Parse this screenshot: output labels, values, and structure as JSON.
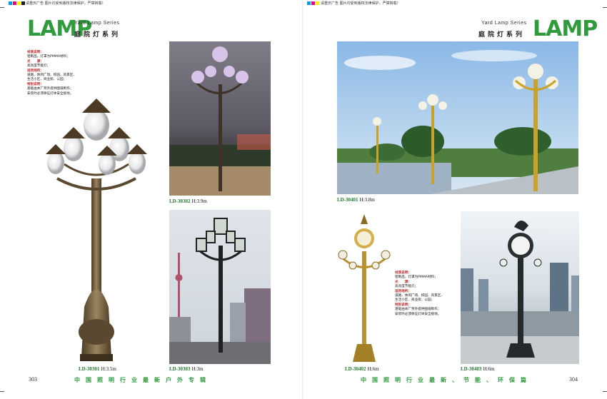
{
  "print_marks": {
    "left_note": "请重庆广告 图片均受到版权法律保护，严禁转载！",
    "right_note": "请重庆广告 图片均受到版权法律保护，严禁转载！",
    "swatch_colors": [
      "#00a0e9",
      "#e4007f",
      "#fff100",
      "#231815",
      "#00a0e9",
      "#e4007f",
      "#fff100"
    ]
  },
  "left_page": {
    "logo": "LAMP",
    "series_en": "Yard Lamp Series",
    "series_cn": "庭院灯系列",
    "specs": [
      {
        "kind": "h",
        "text": "材质说明："
      },
      {
        "kind": "t",
        "text": "铝制品，灯罩为PMMA材料；"
      },
      {
        "kind": "h",
        "text": "光　　源："
      },
      {
        "kind": "t",
        "text": "高亮度节能灯；"
      },
      {
        "kind": "h",
        "text": "适用场所："
      },
      {
        "kind": "t",
        "text": "道路、休闲广场、校园、风景区、"
      },
      {
        "kind": "t",
        "text": "生活小区、商业街、公园；"
      },
      {
        "kind": "h",
        "text": "特别说明："
      },
      {
        "kind": "t",
        "text": "基础由本厂另外提供图纸制作；"
      },
      {
        "kind": "t",
        "text": "安装时必须保证灯体安全接地。"
      }
    ],
    "products": [
      {
        "code": "LD-30301",
        "height": "H:3.5m"
      },
      {
        "code": "LD-30302",
        "height": "H:3.9m"
      },
      {
        "code": "LD-30303",
        "height": "H:3m"
      }
    ],
    "page_number": "303",
    "footer": "中国照明行业最新户外专辑"
  },
  "right_page": {
    "logo": "LAMP",
    "series_en": "Yard Lamp Series",
    "series_cn": "庭院灯系列",
    "specs": [
      {
        "kind": "h",
        "text": "材质说明："
      },
      {
        "kind": "t",
        "text": "铝制品，灯罩为PMMA材料；"
      },
      {
        "kind": "h",
        "text": "光　　源："
      },
      {
        "kind": "t",
        "text": "高亮度节能灯；"
      },
      {
        "kind": "h",
        "text": "适用场所："
      },
      {
        "kind": "t",
        "text": "道路、休闲广场、校园、风景区、"
      },
      {
        "kind": "t",
        "text": "生活小区、商业街、公园；"
      },
      {
        "kind": "h",
        "text": "特别说明："
      },
      {
        "kind": "t",
        "text": "基础由本厂另外提供图纸制作；"
      },
      {
        "kind": "t",
        "text": "安装时必须保证灯体安全接地。"
      }
    ],
    "products": [
      {
        "code": "LD-30401",
        "height": "H:3.8m"
      },
      {
        "code": "LD-30402",
        "height": "H:6m"
      },
      {
        "code": "LD-30403",
        "height": "H:6m"
      }
    ],
    "page_number": "304",
    "footer": "中国照明行业最新、节能、环保篇"
  },
  "colors": {
    "brand_green": "#2f9b3c",
    "spec_heading_red": "#c0282c",
    "bronze": "#6e5a3a",
    "gold": "#c9a227"
  }
}
